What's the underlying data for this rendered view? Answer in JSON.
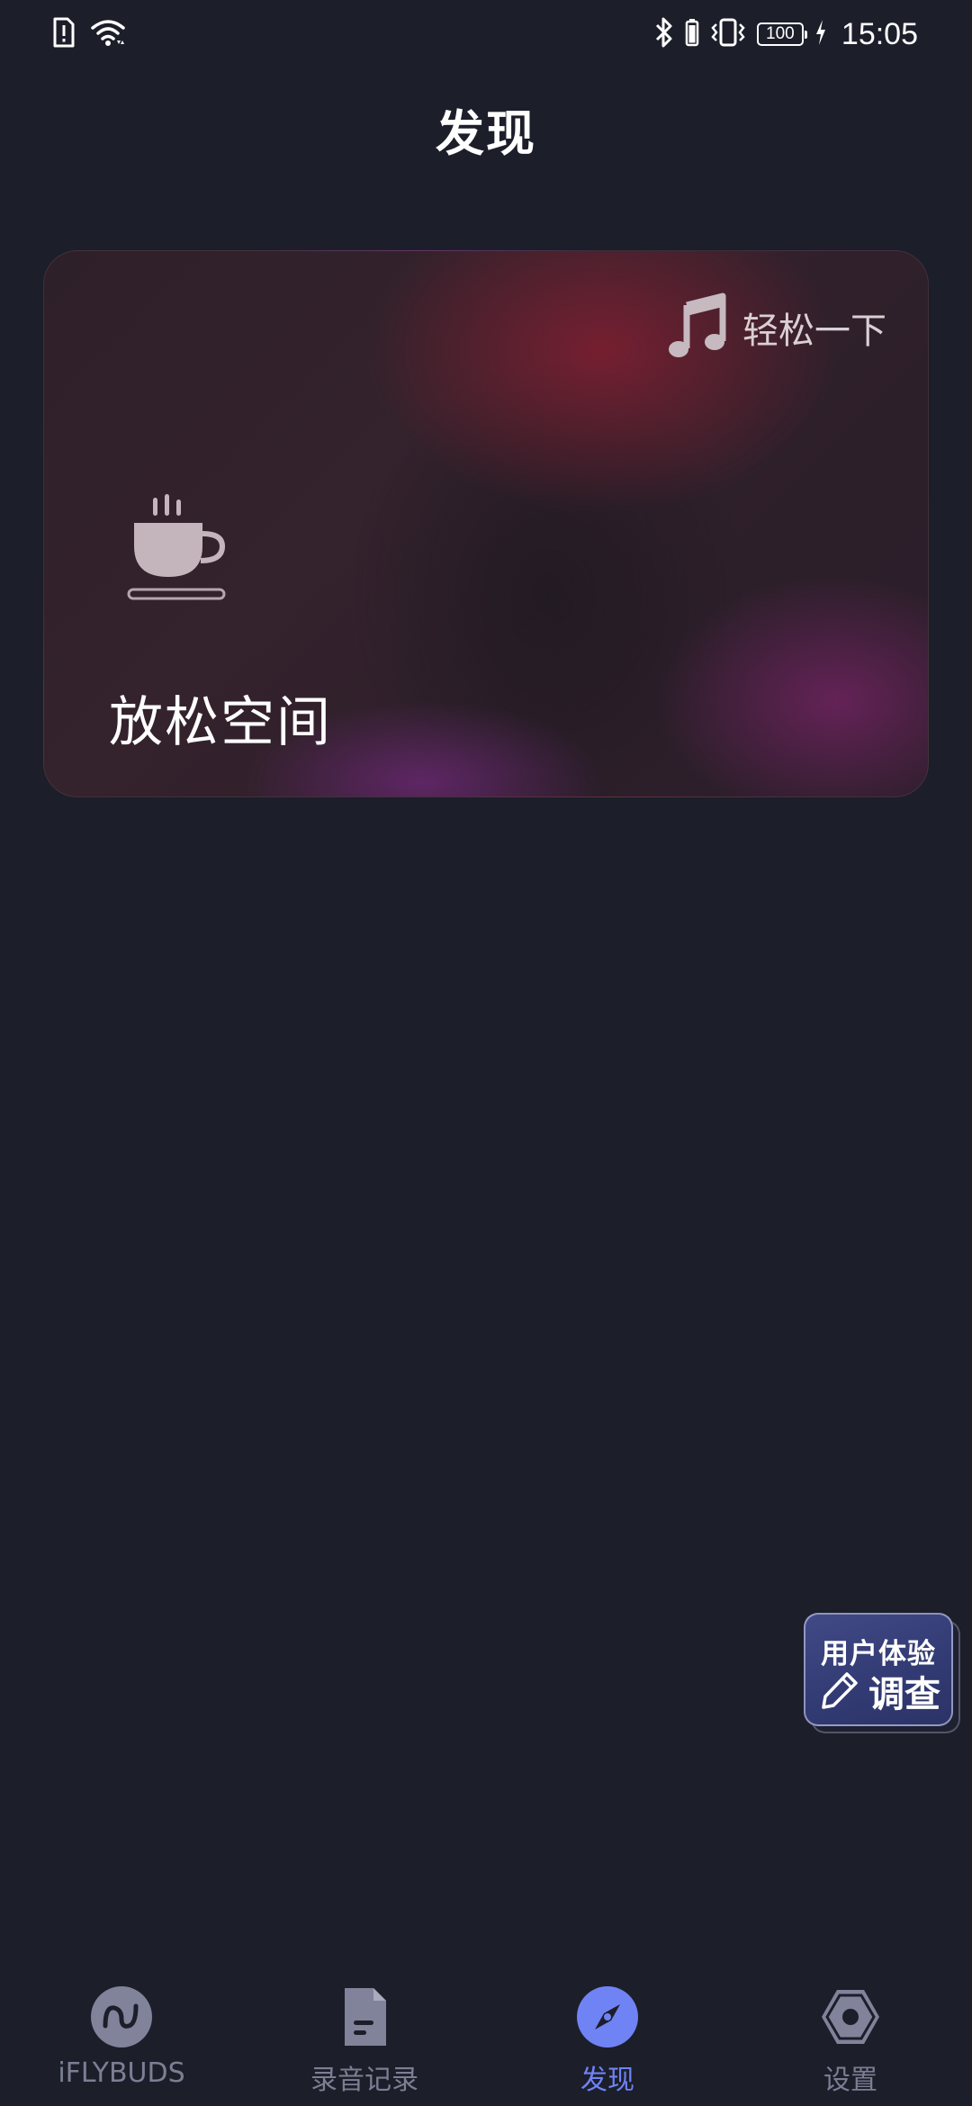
{
  "status_bar": {
    "time": "15:05",
    "battery": "100",
    "left_icons": [
      "sim-alert-icon",
      "wifi-icon"
    ],
    "right_icons": [
      "bluetooth-icon",
      "vibrate-icon",
      "battery-icon",
      "charging-icon"
    ]
  },
  "header": {
    "title": "发现"
  },
  "card": {
    "tag_label": "轻松一下",
    "title": "放松空间",
    "tag_icon": "music-note-icon",
    "main_icon": "coffee-cup-icon"
  },
  "survey": {
    "line1": "用户体验",
    "line2": "调查",
    "icon": "pencil-icon"
  },
  "nav": {
    "items": [
      {
        "label": "iFLYBUDS",
        "icon": "iflybuds-icon",
        "active": false
      },
      {
        "label": "录音记录",
        "icon": "document-icon",
        "active": false
      },
      {
        "label": "发现",
        "icon": "compass-icon",
        "active": true
      },
      {
        "label": "设置",
        "icon": "settings-hexagon-icon",
        "active": false
      }
    ]
  },
  "colors": {
    "background": "#1c1e2a",
    "nav_active": "#6f83f5",
    "nav_inactive": "#7c7f93"
  }
}
